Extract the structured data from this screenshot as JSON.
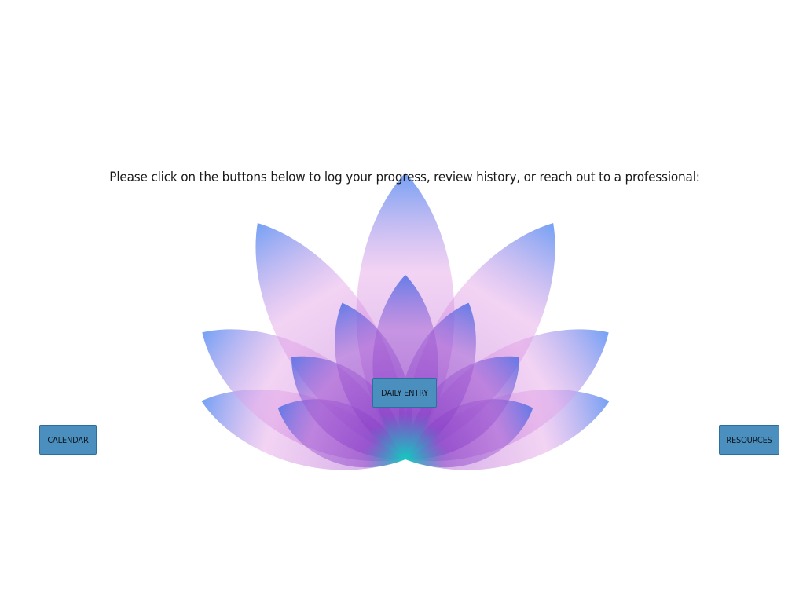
{
  "instruction_text": "Please click on the buttons below to log your progress, review history, or reach out to a professional:",
  "buttons": {
    "daily_entry": "DAILY ENTRY",
    "calendar": "CALENDAR",
    "resources": "RESOURCES"
  },
  "colors": {
    "button_bg": "#4a8fbe",
    "button_border": "#2d6f9c",
    "petal_blue": "#6f9df5",
    "petal_pink": "#e8a8e8",
    "petal_purple": "#9a4fd0",
    "petal_teal": "#20d0c0"
  },
  "icons": {
    "background_art": "lotus-flower-illustration"
  }
}
